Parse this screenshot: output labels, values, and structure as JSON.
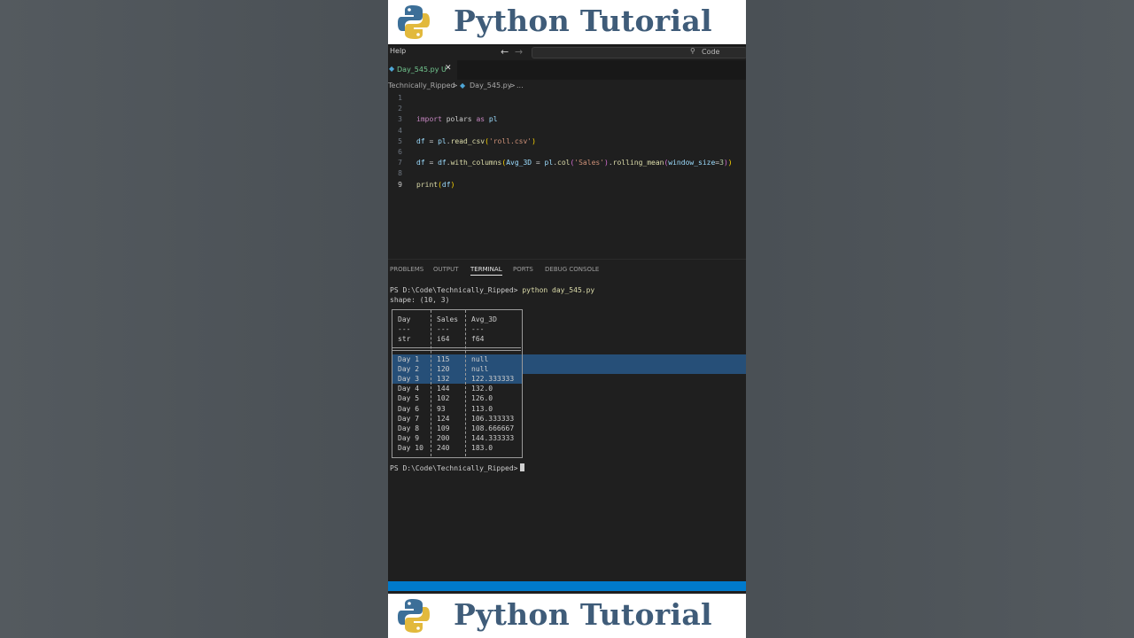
{
  "banner": {
    "title": "Python Tutorial"
  },
  "titlebar": {
    "menu_help": "Help",
    "back_glyph": "←",
    "forward_glyph": "→",
    "search_glyph": "⚲",
    "command_center_label": "Code"
  },
  "tab": {
    "filename": "Day_545.py",
    "status": "U",
    "close_glyph": "✕",
    "icon": "python-file-icon"
  },
  "breadcrumb": {
    "folder": "Technically_Ripped",
    "sep": ">",
    "file": "Day_545.py",
    "more": "..."
  },
  "editor": {
    "lines": [
      {
        "num": "1"
      },
      {
        "num": "2"
      },
      {
        "num": "3",
        "tokens": [
          [
            "kw",
            "import"
          ],
          [
            "plain",
            " polars "
          ],
          [
            "kw",
            "as"
          ],
          [
            "plain",
            " "
          ],
          [
            "var",
            "pl"
          ]
        ]
      },
      {
        "num": "4"
      },
      {
        "num": "5",
        "tokens": [
          [
            "var",
            "df"
          ],
          [
            "plain",
            " = "
          ],
          [
            "var",
            "pl"
          ],
          [
            "plain",
            "."
          ],
          [
            "fn",
            "read_csv"
          ],
          [
            "bracket1",
            "("
          ],
          [
            "str",
            "'roll.csv'"
          ],
          [
            "bracket1",
            ")"
          ]
        ]
      },
      {
        "num": "6"
      },
      {
        "num": "7",
        "tokens": [
          [
            "var",
            "df"
          ],
          [
            "plain",
            " = "
          ],
          [
            "var",
            "df"
          ],
          [
            "plain",
            "."
          ],
          [
            "fn",
            "with_columns"
          ],
          [
            "bracket1",
            "("
          ],
          [
            "var",
            "Avg_3D"
          ],
          [
            "plain",
            " = "
          ],
          [
            "var",
            "pl"
          ],
          [
            "plain",
            "."
          ],
          [
            "fn",
            "col"
          ],
          [
            "bracket2",
            "("
          ],
          [
            "str",
            "'Sales'"
          ],
          [
            "bracket2",
            ")"
          ],
          [
            "plain",
            "."
          ],
          [
            "fn",
            "rolling_mean"
          ],
          [
            "bracket2",
            "("
          ],
          [
            "var",
            "window_size"
          ],
          [
            "plain",
            "="
          ],
          [
            "num",
            "3"
          ],
          [
            "bracket2",
            ")"
          ],
          [
            "bracket1",
            ")"
          ]
        ]
      },
      {
        "num": "8"
      },
      {
        "num": "9",
        "tokens": [
          [
            "fn",
            "print"
          ],
          [
            "bracket1",
            "("
          ],
          [
            "var",
            "df"
          ],
          [
            "bracket1",
            ")"
          ]
        ]
      }
    ]
  },
  "panel": {
    "tabs": [
      "PROBLEMS",
      "OUTPUT",
      "TERMINAL",
      "PORTS",
      "DEBUG CONSOLE"
    ],
    "active": "TERMINAL"
  },
  "terminal": {
    "prompt": "PS D:\\Code\\Technically_Ripped>",
    "command": "python day_545.py",
    "shape": "shape: (10, 3)",
    "columns": [
      "Day",
      "Sales",
      "Avg_3D"
    ],
    "dashes": [
      "---",
      "---",
      "---"
    ],
    "dtypes": [
      "str",
      "i64",
      "f64"
    ],
    "rows": [
      [
        "Day 1",
        "115",
        "null"
      ],
      [
        "Day 2",
        "120",
        "null"
      ],
      [
        "Day 3",
        "132",
        "122.333333"
      ],
      [
        "Day 4",
        "144",
        "132.0"
      ],
      [
        "Day 5",
        "102",
        "126.0"
      ],
      [
        "Day 6",
        "93",
        "113.0"
      ],
      [
        "Day 7",
        "124",
        "106.333333"
      ],
      [
        "Day 8",
        "109",
        "108.666667"
      ],
      [
        "Day 9",
        "200",
        "144.333333"
      ],
      [
        "Day 10",
        "240",
        "183.0"
      ]
    ],
    "selected_rows": [
      0,
      1,
      2
    ],
    "final_prompt": "PS D:\\Code\\Technically_Ripped>"
  },
  "colors": {
    "accent": "#007acc",
    "banner_title": "#3f5c79",
    "selection": "#264f78"
  }
}
